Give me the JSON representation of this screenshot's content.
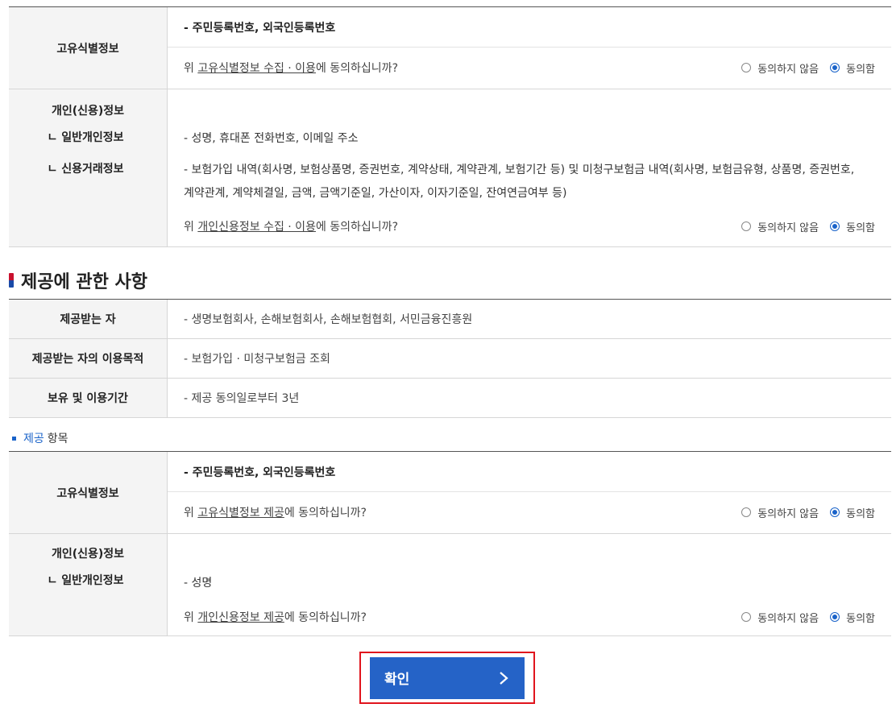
{
  "collect_items": {
    "unique_id": {
      "header": "고유식별정보",
      "detail": "- 주민등록번호, 외국인등록번호",
      "question_prefix": "위 ",
      "question_link": "고유식별정보 수집 · 이용",
      "question_suffix": "에 동의하십니까?",
      "disagree": "동의하지 않음",
      "agree": "동의함"
    },
    "personal_credit": {
      "header": "개인(신용)정보",
      "sub1": "ㄴ 일반개인정보",
      "sub2": "ㄴ 신용거래정보",
      "detail1": "- 성명, 휴대폰 전화번호, 이메일 주소",
      "detail2a": "- 보험가입 내역(회사명, 보험상품명, 증권번호, 계약상태, 계약관계, 보험기간 등) 및 미청구보험금 내역(회사명, 보험금유형, 상품명, 증권번호,",
      "detail2b": "계약관계, 계약체결일, 금액, 금액기준일, 가산이자, 이자기준일, 잔여연금여부 등)",
      "question_prefix": "위 ",
      "question_link": "개인신용정보 수집 · 이용",
      "question_suffix": "에 동의하십니까?",
      "disagree": "동의하지 않음",
      "agree": "동의함"
    }
  },
  "provision_section": {
    "title": "제공에 관한 사항",
    "rows": [
      {
        "header": "제공받는 자",
        "value": "- 생명보험회사, 손해보험회사, 손해보험협회, 서민금융진흥원"
      },
      {
        "header": "제공받는 자의 이용목적",
        "value": "- 보험가입 · 미청구보험금 조회"
      },
      {
        "header": "보유 및 이용기간",
        "value": "- 제공 동의일로부터 3년"
      }
    ],
    "items_label_blue": "제공",
    "items_label_rest": "항목"
  },
  "provide_items": {
    "unique_id": {
      "header": "고유식별정보",
      "detail": "- 주민등록번호, 외국인등록번호",
      "question_prefix": "위 ",
      "question_link": "고유식별정보 제공",
      "question_suffix": "에 동의하십니까?",
      "disagree": "동의하지 않음",
      "agree": "동의함"
    },
    "personal_credit": {
      "header": "개인(신용)정보",
      "sub1": "ㄴ 일반개인정보",
      "detail1": "- 성명",
      "question_prefix": "위 ",
      "question_link": "개인신용정보 제공",
      "question_suffix": "에 동의하십니까?",
      "disagree": "동의하지 않음",
      "agree": "동의함"
    }
  },
  "confirm_button": {
    "label": "확인",
    "icon": "chevron-right-icon"
  },
  "colors": {
    "accent": "#2563c7",
    "highlight_border": "#e0141d",
    "radio_selected": "#1a63c9"
  }
}
